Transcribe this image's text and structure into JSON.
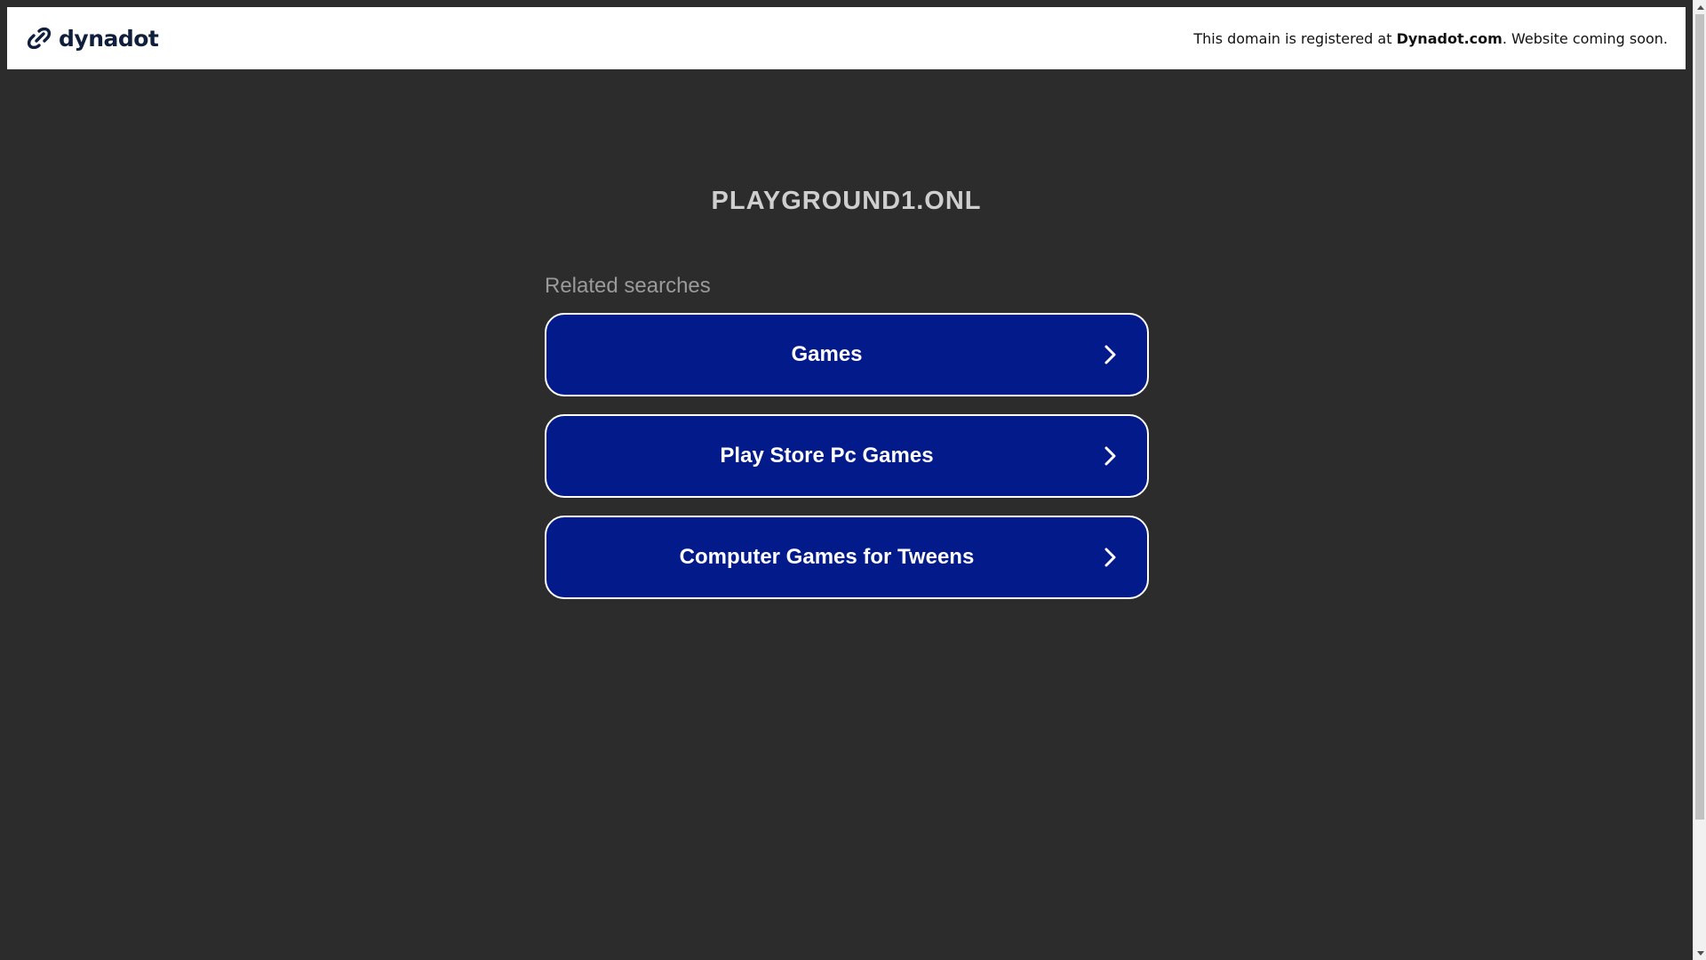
{
  "brand": {
    "logo_text": "dynadot",
    "logo_icon": "dynadot-link-icon",
    "color": "#0f1e3c"
  },
  "notice": {
    "prefix": "This domain is registered at ",
    "registrar": "Dynadot.com",
    "suffix": ". Website coming soon."
  },
  "domain": "PLAYGROUND1.ONL",
  "related_heading": "Related searches",
  "results": [
    {
      "label": "Games",
      "icon": "chevron-right-icon"
    },
    {
      "label": "Play Store Pc Games",
      "icon": "chevron-right-icon"
    },
    {
      "label": "Computer Games for Tweens",
      "icon": "chevron-right-icon"
    }
  ],
  "colors": {
    "background": "#2c2c2c",
    "button": "#031a8a",
    "button_border": "#ffffff",
    "title": "#cfcfcf",
    "related": "#9a9a9a"
  }
}
